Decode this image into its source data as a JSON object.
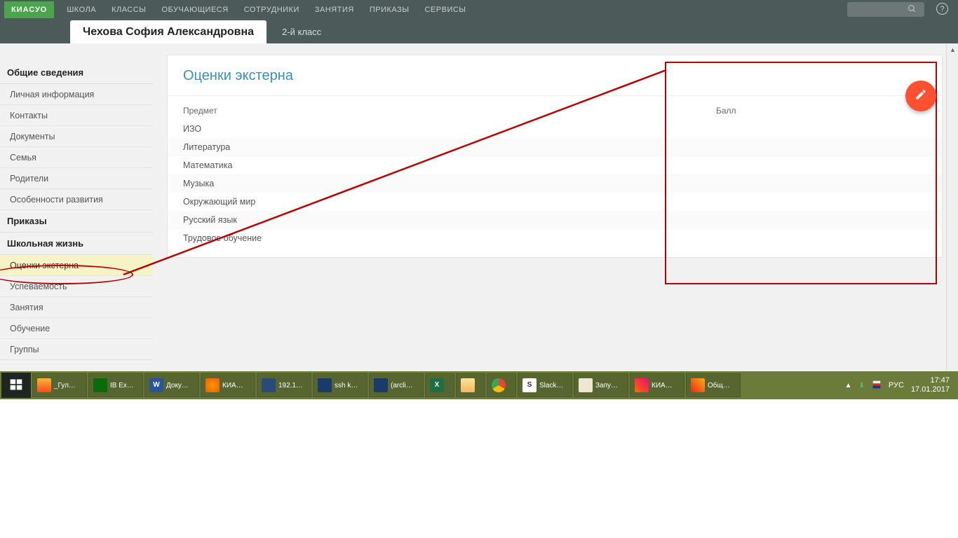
{
  "logo": "КИАСУО",
  "topnav": [
    "ШКОЛА",
    "КЛАССЫ",
    "ОБУЧАЮЩИЕСЯ",
    "СОТРУДНИКИ",
    "ЗАНЯТИЯ",
    "ПРИКАЗЫ",
    "СЕРВИСЫ"
  ],
  "search_placeholder": "Поиск",
  "person_name": "Чехова София Александровна",
  "class_label": "2-й класс",
  "sidebar": {
    "groups": [
      {
        "title": "Общие сведения",
        "items": [
          "Личная информация",
          "Контакты",
          "Документы",
          "Семья",
          "Родители",
          "Особенности развития"
        ]
      },
      {
        "title": "Приказы",
        "items": []
      },
      {
        "title": "Школьная жизнь",
        "items": [
          "Оценки экстерна",
          "Успеваемость",
          "Занятия",
          "Обучение",
          "Группы"
        ]
      }
    ],
    "active": "Оценки экстерна"
  },
  "card": {
    "title": "Оценки экстерна",
    "col1": "Предмет",
    "col2": "Балл",
    "rows": [
      "ИЗО",
      "Литература",
      "Математика",
      "Музыка",
      "Окружающий мир",
      "Русский язык",
      "Трудовое обучение"
    ]
  },
  "taskbar": {
    "items": [
      "_Гул…",
      "IB Ex…",
      "Доку…",
      "КИА…",
      "192.1…",
      "ssh k…",
      "(arcli…",
      "",
      "",
      "Slack…",
      "Запу…",
      "КИА…",
      "Общ…"
    ],
    "lang": "РУС",
    "time": "17:47",
    "date": "17.01.2017"
  }
}
